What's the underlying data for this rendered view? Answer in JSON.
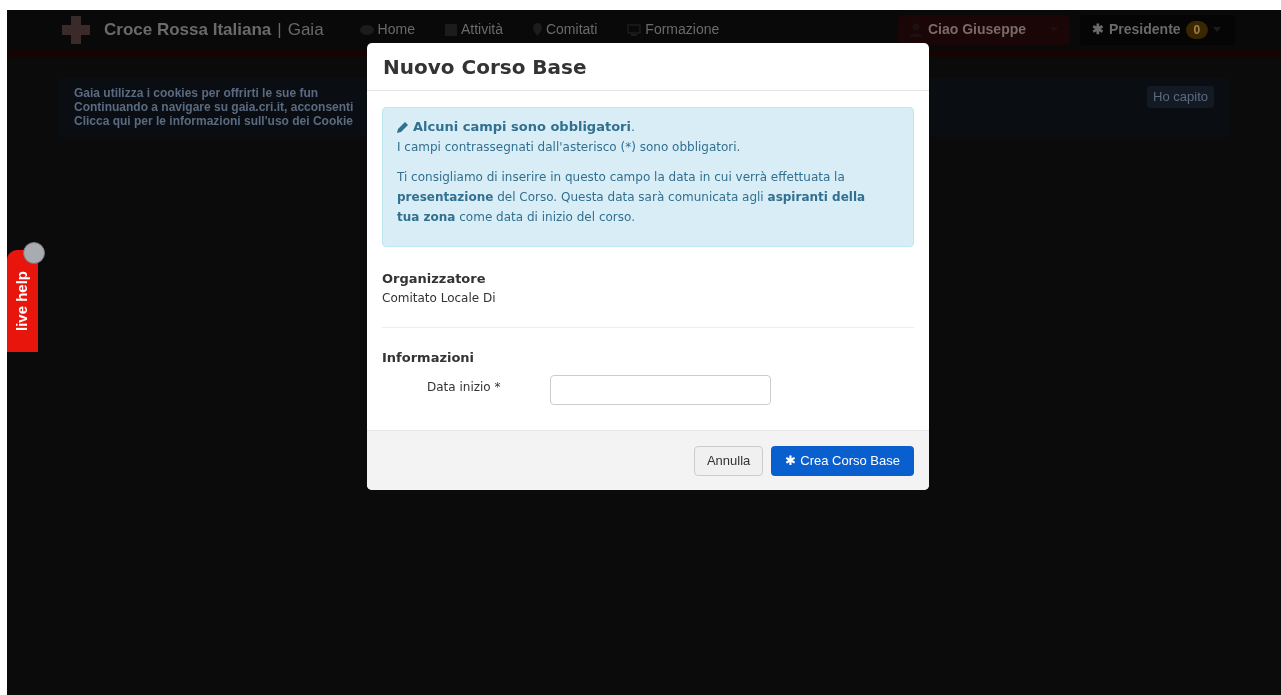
{
  "navbar": {
    "brand": "Croce Rossa Italiana",
    "separator": "|",
    "brand_suffix": "Gaia",
    "items": [
      {
        "label": "Home"
      },
      {
        "label": "Attività"
      },
      {
        "label": "Comitati"
      },
      {
        "label": "Formazione"
      }
    ],
    "user_button": "Ciao Giuseppe",
    "role_icon": "✱",
    "role_button": "Presidente",
    "role_badge": "0"
  },
  "cookie_banner": {
    "lines": [
      "Gaia utilizza i cookies per offrirti le sue fun",
      "Continuando a navigare su gaia.cri.it, acconsenti",
      "Clicca qui per le informazioni sull'uso dei Cookie"
    ],
    "dismiss": "Ho capito"
  },
  "live_help": {
    "label": "live help"
  },
  "modal": {
    "title": "Nuovo Corso Base",
    "alert": {
      "heading": "**Alcuni campi sono obbligatori**.",
      "line": "I campi contrassegnati dall'asterisco (*) sono obbligatori.",
      "paragraph": "Ti consigliamo di inserire in questo campo la data in cui verrà effettuata la **presentazione** del Corso. Questa data sarà comunicata agli **aspiranti della tua zona** come data di inizio del corso."
    },
    "organizer": {
      "heading": "Organizzatore",
      "value": "Comitato Locale Di"
    },
    "section": "Informazioni",
    "fields": [
      {
        "label": "Data inizio *"
      }
    ],
    "buttons": [
      {
        "label": "Annulla",
        "kind": "default"
      },
      {
        "label": "Crea Corso Base",
        "icon": "✱",
        "kind": "primary"
      }
    ]
  }
}
